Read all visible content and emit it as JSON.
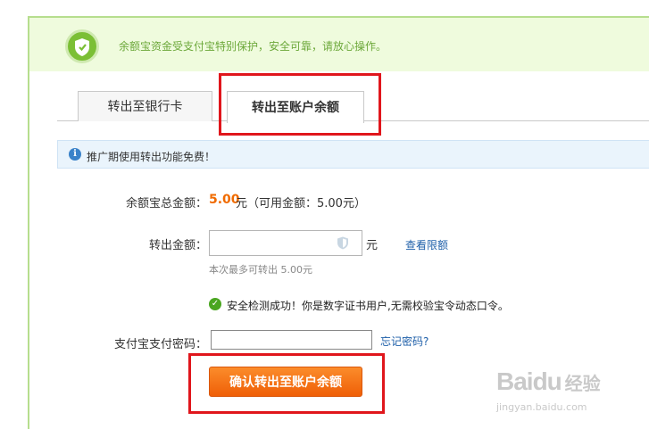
{
  "banner": {
    "text": "余额宝资金受支付宝特别保护，安全可靠，请放心操作。"
  },
  "tabs": [
    {
      "label": "转出至银行卡",
      "active": false
    },
    {
      "label": "转出至账户余额",
      "active": true
    }
  ],
  "notice": {
    "text": "推广期使用转出功能免费！"
  },
  "form": {
    "total_label": "余额宝总金额：",
    "total_value": "5.00",
    "total_rest": "元（可用金额：5.00元）",
    "amount_label": "转出金额：",
    "amount_value": "",
    "amount_unit": "元",
    "limit_link": "查看限额",
    "amount_hint": "本次最多可转出 5.00元",
    "security_text": "安全检测成功！你是数字证书用户,无需校验宝令动态口令。",
    "password_label": "支付宝支付密码：",
    "password_value": "",
    "forgot_link": "忘记密码?",
    "confirm_label": "确认转出至账户余额"
  },
  "watermark": {
    "logo": "Baidu",
    "cn": "经验",
    "url": "jingyan.baidu.com"
  },
  "colors": {
    "accent_orange": "#f06b00",
    "banner_green": "#6ca83a",
    "link_blue": "#1e5fa9",
    "annotation_red": "#e0161c"
  },
  "icons": {
    "banner": "shield-icon",
    "notice": "info-icon",
    "security": "check-circle-icon",
    "input": "shield-icon"
  }
}
